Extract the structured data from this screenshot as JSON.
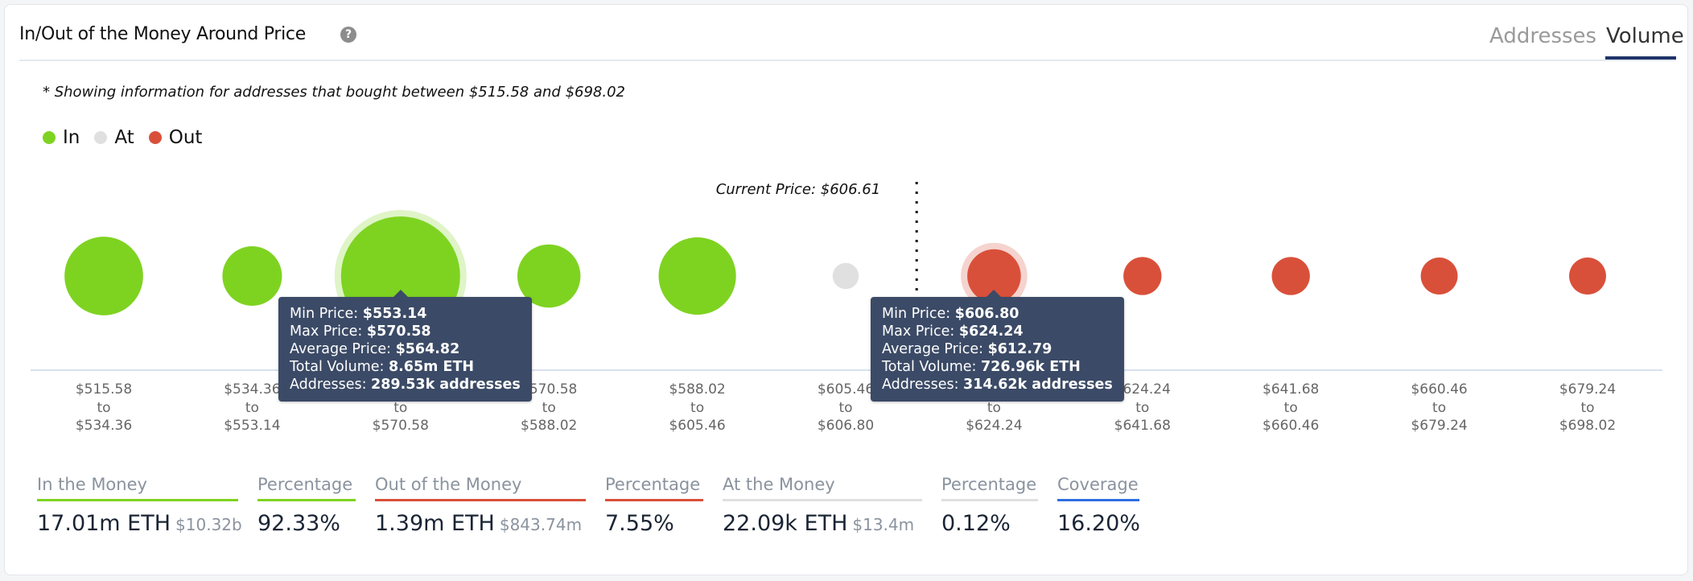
{
  "header": {
    "title": "In/Out of the Money Around Price",
    "help_icon": "question-circle-icon",
    "tabs": [
      {
        "label": "Addresses",
        "active": false
      },
      {
        "label": "Volume",
        "active": true
      }
    ]
  },
  "note": "* Showing information for addresses that bought between $515.58 and $698.02",
  "colors": {
    "in": "#7ed321",
    "at": "#e0e0e0",
    "out": "#d9503a",
    "coverage": "#2d6fe0",
    "tooltip_bg": "#3b4a66",
    "active_tab": "#1f3468"
  },
  "legend": [
    {
      "label": "In",
      "status": "in"
    },
    {
      "label": "At",
      "status": "at"
    },
    {
      "label": "Out",
      "status": "out"
    }
  ],
  "chart_data": {
    "type": "scatter",
    "subtype": "bubble",
    "title": "In/Out of the Money Around Price",
    "current_price_label": "Current Price: $606.61",
    "current_price": 606.61,
    "current_price_after_bin_index": 5,
    "bins": [
      {
        "from": "$515.58",
        "to": "$534.36",
        "status": "in",
        "relative_size": 0.66
      },
      {
        "from": "$534.36",
        "to": "$553.14",
        "status": "in",
        "relative_size": 0.5
      },
      {
        "from": "$553.14",
        "to": "$570.58",
        "status": "in",
        "relative_size": 1.0,
        "highlighted": true
      },
      {
        "from": "$570.58",
        "to": "$588.02",
        "status": "in",
        "relative_size": 0.53
      },
      {
        "from": "$588.02",
        "to": "$605.46",
        "status": "in",
        "relative_size": 0.65
      },
      {
        "from": "$605.46",
        "to": "$606.80",
        "status": "at",
        "relative_size": 0.22
      },
      {
        "from": "$606.80",
        "to": "$624.24",
        "status": "out",
        "relative_size": 0.45,
        "highlighted": true
      },
      {
        "from": "$624.24",
        "to": "$641.68",
        "status": "out",
        "relative_size": 0.32
      },
      {
        "from": "$641.68",
        "to": "$660.46",
        "status": "out",
        "relative_size": 0.32
      },
      {
        "from": "$660.46",
        "to": "$679.24",
        "status": "out",
        "relative_size": 0.31
      },
      {
        "from": "$679.24",
        "to": "$698.02",
        "status": "out",
        "relative_size": 0.31
      }
    ],
    "to_word": "to",
    "tooltips": [
      {
        "bin_index": 2,
        "rows": [
          {
            "label": "Min Price: ",
            "value": "$553.14"
          },
          {
            "label": "Max Price: ",
            "value": "$570.58"
          },
          {
            "label": "Average Price: ",
            "value": "$564.82"
          },
          {
            "label": "Total Volume: ",
            "value": "8.65m ETH"
          },
          {
            "label": "Addresses: ",
            "value": "289.53k addresses"
          }
        ]
      },
      {
        "bin_index": 6,
        "rows": [
          {
            "label": "Min Price: ",
            "value": "$606.80"
          },
          {
            "label": "Max Price: ",
            "value": "$624.24"
          },
          {
            "label": "Average Price: ",
            "value": "$612.79"
          },
          {
            "label": "Total Volume: ",
            "value": "726.96k ETH"
          },
          {
            "label": "Addresses: ",
            "value": "314.62k addresses"
          }
        ]
      }
    ]
  },
  "stats": [
    {
      "label": "In the Money",
      "value": "17.01m ETH",
      "sub": "$10.32b",
      "color_key": "in"
    },
    {
      "label": "Percentage",
      "value": "92.33%",
      "sub": "",
      "color_key": "in"
    },
    {
      "label": "Out of the Money",
      "value": "1.39m ETH",
      "sub": "$843.74m",
      "color_key": "out"
    },
    {
      "label": "Percentage",
      "value": "7.55%",
      "sub": "",
      "color_key": "out"
    },
    {
      "label": "At the Money",
      "value": "22.09k ETH",
      "sub": "$13.4m",
      "color_key": "at"
    },
    {
      "label": "Percentage",
      "value": "0.12%",
      "sub": "",
      "color_key": "at"
    },
    {
      "label": "Coverage",
      "value": "16.20%",
      "sub": "",
      "color_key": "coverage"
    }
  ]
}
